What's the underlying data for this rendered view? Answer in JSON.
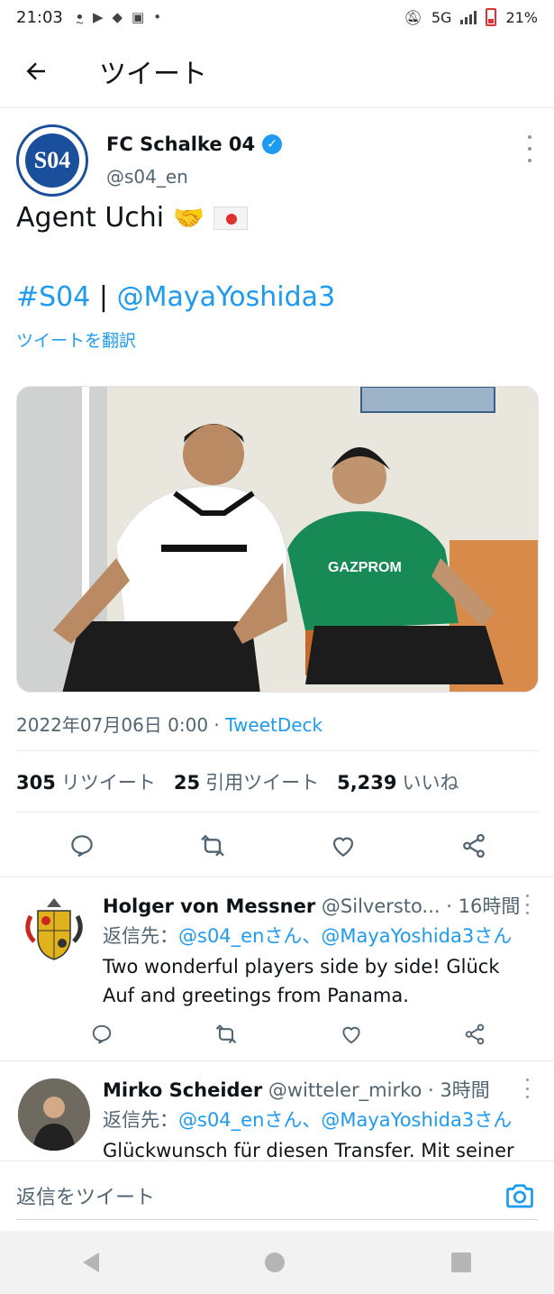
{
  "status_bar": {
    "time": "21:03",
    "network": "5G",
    "battery": "21%",
    "notification_icons": [
      "voice-icon",
      "youtube-icon",
      "game-icon",
      "line-manga-icon",
      "dot-icon"
    ]
  },
  "header": {
    "title": "ツイート"
  },
  "tweet": {
    "author_name": "FC Schalke 04",
    "author_handle": "@s04_en",
    "avatar_text": "S04",
    "text": "Agent Uchi",
    "hashtag": "#S04",
    "separator": "|",
    "mention": "@MayaYoshida3",
    "translate_label": "ツイートを翻訳",
    "timestamp": "2022年07月06日 0:00 · ",
    "client": "TweetDeck",
    "stats": {
      "retweets_count": "305",
      "retweets_label": "リツイート",
      "quotes_count": "25",
      "quotes_label": "引用ツイート",
      "likes_count": "5,239",
      "likes_label": "いいね"
    }
  },
  "replies": [
    {
      "name": "Holger von Messner",
      "handle_time": "@Silversto... · 16時間",
      "reply_to_label": "返信先：",
      "reply_to": "@s04_enさん、@MayaYoshida3さん",
      "text": "Two wonderful players side by side! Glück Auf and greetings from Panama."
    },
    {
      "name": "Mirko Scheider",
      "handle_time": "@witteler_mirko · 3時間",
      "reply_to_label": "返信先：",
      "reply_to": "@s04_enさん、@MayaYoshida3さん",
      "text": "Glückwunsch für diesen Transfer. Mit seiner"
    }
  ],
  "composer": {
    "placeholder": "返信をツイート"
  },
  "colors": {
    "accent": "#1d9bf0",
    "schalke_blue": "#1a4f9c",
    "text": "#0f1419",
    "secondary": "#536471"
  }
}
